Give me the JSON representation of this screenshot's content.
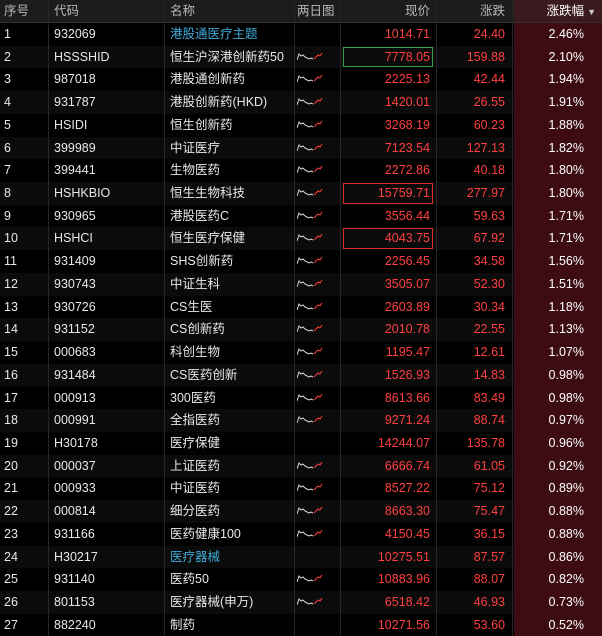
{
  "header": {
    "idx": "序号",
    "code": "代码",
    "name": "名称",
    "spark": "两日图",
    "price": "现价",
    "change": "涨跌",
    "pct": "涨跌幅",
    "sort_icon": "sort-desc-icon"
  },
  "colors": {
    "up": "#ff4040",
    "link": "#3fa9d8",
    "green_box": "#2ea34a",
    "red_box": "#d23030",
    "pct_bg": "#3c0c12"
  },
  "rows": [
    {
      "idx": "1",
      "code": "932069",
      "name": "港股通医疗主题",
      "price": "1014.71",
      "change": "24.40",
      "pct": "2.46%",
      "link": true,
      "spark": false,
      "box": ""
    },
    {
      "idx": "2",
      "code": "HSSSHID",
      "name": "恒生沪深港创新药50",
      "price": "7778.05",
      "change": "159.88",
      "pct": "2.10%",
      "link": false,
      "spark": true,
      "box": "green"
    },
    {
      "idx": "3",
      "code": "987018",
      "name": "港股通创新药",
      "price": "2225.13",
      "change": "42.44",
      "pct": "1.94%",
      "link": false,
      "spark": true,
      "box": ""
    },
    {
      "idx": "4",
      "code": "931787",
      "name": "港股创新药(HKD)",
      "price": "1420.01",
      "change": "26.55",
      "pct": "1.91%",
      "link": false,
      "spark": true,
      "box": ""
    },
    {
      "idx": "5",
      "code": "HSIDI",
      "name": "恒生创新药",
      "price": "3268.19",
      "change": "60.23",
      "pct": "1.88%",
      "link": false,
      "spark": true,
      "box": ""
    },
    {
      "idx": "6",
      "code": "399989",
      "name": "中证医疗",
      "price": "7123.54",
      "change": "127.13",
      "pct": "1.82%",
      "link": false,
      "spark": true,
      "box": ""
    },
    {
      "idx": "7",
      "code": "399441",
      "name": "生物医药",
      "price": "2272.86",
      "change": "40.18",
      "pct": "1.80%",
      "link": false,
      "spark": true,
      "box": ""
    },
    {
      "idx": "8",
      "code": "HSHKBIO",
      "name": "恒生生物科技",
      "price": "15759.71",
      "change": "277.97",
      "pct": "1.80%",
      "link": false,
      "spark": true,
      "box": "red"
    },
    {
      "idx": "9",
      "code": "930965",
      "name": "港股医药C",
      "price": "3556.44",
      "change": "59.63",
      "pct": "1.71%",
      "link": false,
      "spark": true,
      "box": ""
    },
    {
      "idx": "10",
      "code": "HSHCI",
      "name": "恒生医疗保健",
      "price": "4043.75",
      "change": "67.92",
      "pct": "1.71%",
      "link": false,
      "spark": true,
      "box": "red"
    },
    {
      "idx": "11",
      "code": "931409",
      "name": "SHS创新药",
      "price": "2256.45",
      "change": "34.58",
      "pct": "1.56%",
      "link": false,
      "spark": true,
      "box": ""
    },
    {
      "idx": "12",
      "code": "930743",
      "name": "中证生科",
      "price": "3505.07",
      "change": "52.30",
      "pct": "1.51%",
      "link": false,
      "spark": true,
      "box": ""
    },
    {
      "idx": "13",
      "code": "930726",
      "name": "CS生医",
      "price": "2603.89",
      "change": "30.34",
      "pct": "1.18%",
      "link": false,
      "spark": true,
      "box": ""
    },
    {
      "idx": "14",
      "code": "931152",
      "name": "CS创新药",
      "price": "2010.78",
      "change": "22.55",
      "pct": "1.13%",
      "link": false,
      "spark": true,
      "box": ""
    },
    {
      "idx": "15",
      "code": "000683",
      "name": "科创生物",
      "price": "1195.47",
      "change": "12.61",
      "pct": "1.07%",
      "link": false,
      "spark": true,
      "box": ""
    },
    {
      "idx": "16",
      "code": "931484",
      "name": "CS医药创新",
      "price": "1526.93",
      "change": "14.83",
      "pct": "0.98%",
      "link": false,
      "spark": true,
      "box": ""
    },
    {
      "idx": "17",
      "code": "000913",
      "name": "300医药",
      "price": "8613.66",
      "change": "83.49",
      "pct": "0.98%",
      "link": false,
      "spark": true,
      "box": ""
    },
    {
      "idx": "18",
      "code": "000991",
      "name": "全指医药",
      "price": "9271.24",
      "change": "88.74",
      "pct": "0.97%",
      "link": false,
      "spark": true,
      "box": ""
    },
    {
      "idx": "19",
      "code": "H30178",
      "name": "医疗保健",
      "price": "14244.07",
      "change": "135.78",
      "pct": "0.96%",
      "link": false,
      "spark": false,
      "box": ""
    },
    {
      "idx": "20",
      "code": "000037",
      "name": "上证医药",
      "price": "6666.74",
      "change": "61.05",
      "pct": "0.92%",
      "link": false,
      "spark": true,
      "box": ""
    },
    {
      "idx": "21",
      "code": "000933",
      "name": "中证医药",
      "price": "8527.22",
      "change": "75.12",
      "pct": "0.89%",
      "link": false,
      "spark": true,
      "box": ""
    },
    {
      "idx": "22",
      "code": "000814",
      "name": "细分医药",
      "price": "8663.30",
      "change": "75.47",
      "pct": "0.88%",
      "link": false,
      "spark": true,
      "box": ""
    },
    {
      "idx": "23",
      "code": "931166",
      "name": "医药健康100",
      "price": "4150.45",
      "change": "36.15",
      "pct": "0.88%",
      "link": false,
      "spark": true,
      "box": ""
    },
    {
      "idx": "24",
      "code": "H30217",
      "name": "医疗器械",
      "price": "10275.51",
      "change": "87.57",
      "pct": "0.86%",
      "link": true,
      "spark": false,
      "box": ""
    },
    {
      "idx": "25",
      "code": "931140",
      "name": "医药50",
      "price": "10883.96",
      "change": "88.07",
      "pct": "0.82%",
      "link": false,
      "spark": true,
      "box": ""
    },
    {
      "idx": "26",
      "code": "801153",
      "name": "医疗器械(申万)",
      "price": "6518.42",
      "change": "46.93",
      "pct": "0.73%",
      "link": false,
      "spark": true,
      "box": ""
    },
    {
      "idx": "27",
      "code": "882240",
      "name": "制药",
      "price": "10271.56",
      "change": "53.60",
      "pct": "0.52%",
      "link": false,
      "spark": false,
      "box": ""
    }
  ]
}
